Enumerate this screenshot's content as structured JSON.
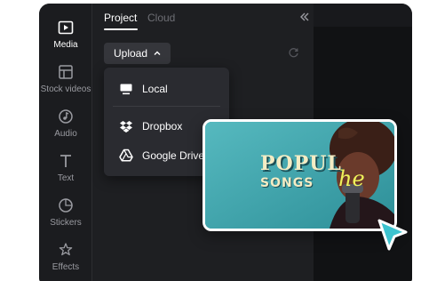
{
  "sidebar": {
    "items": [
      {
        "label": "Media",
        "icon": "media-icon",
        "active": true
      },
      {
        "label": "Stock videos",
        "icon": "stock-videos-icon",
        "active": false
      },
      {
        "label": "Audio",
        "icon": "audio-icon",
        "active": false
      },
      {
        "label": "Text",
        "icon": "text-icon",
        "active": false
      },
      {
        "label": "Stickers",
        "icon": "stickers-icon",
        "active": false
      },
      {
        "label": "Effects",
        "icon": "effects-icon",
        "active": false
      }
    ]
  },
  "panel": {
    "tabs": [
      {
        "label": "Project",
        "active": true
      },
      {
        "label": "Cloud",
        "active": false
      }
    ],
    "collapse_icon": "double-chevron-left-icon",
    "upload_label": "Upload",
    "upload_icon": "chevron-up-icon",
    "refresh_icon": "refresh-icon"
  },
  "upload_menu": {
    "items": [
      {
        "label": "Local",
        "icon": "monitor-icon"
      },
      {
        "label": "Dropbox",
        "icon": "dropbox-icon"
      },
      {
        "label": "Google Drive",
        "icon": "google-drive-icon"
      }
    ]
  },
  "thumbnail": {
    "title": "POPUL",
    "subtitle": "SONGS",
    "script": "he"
  },
  "colors": {
    "app_bg": "#1e1f22",
    "menu_bg": "#2a2b30",
    "thumb_teal": "#3fa9b0",
    "thumb_text": "#f4ecc4",
    "thumb_script": "#eef25a",
    "cursor": "#3cc3cf"
  }
}
